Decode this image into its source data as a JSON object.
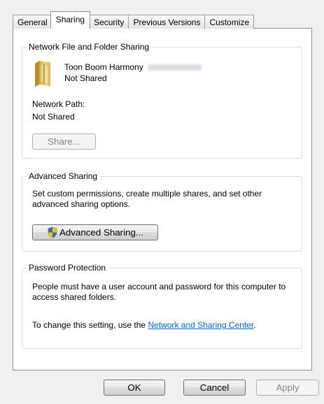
{
  "tabs": [
    {
      "label": "General",
      "active": false
    },
    {
      "label": "Sharing",
      "active": true
    },
    {
      "label": "Security",
      "active": false
    },
    {
      "label": "Previous Versions",
      "active": false
    },
    {
      "label": "Customize",
      "active": false
    }
  ],
  "network_sharing": {
    "title": "Network File and Folder Sharing",
    "folder_icon": "folder-icon",
    "folder_name": "Toon Boom Harmony",
    "status": "Not Shared",
    "path_label": "Network Path:",
    "path_value": "Not Shared",
    "share_button": "Share..."
  },
  "advanced_sharing": {
    "title": "Advanced Sharing",
    "description": "Set custom permissions, create multiple shares, and set other advanced sharing options.",
    "button": "Advanced Sharing...",
    "button_icon": "uac-shield-icon"
  },
  "password_protection": {
    "title": "Password Protection",
    "description": "People must have a user account and password for this computer to access shared folders.",
    "change_prefix": "To change this setting, use the ",
    "link": "Network and Sharing Center",
    "change_suffix": "."
  },
  "footer": {
    "ok": "OK",
    "cancel": "Cancel",
    "apply": "Apply"
  },
  "colors": {
    "link": "#0066cc",
    "dialog_bg": "#f0f0f0",
    "page_bg": "#ffffff"
  }
}
